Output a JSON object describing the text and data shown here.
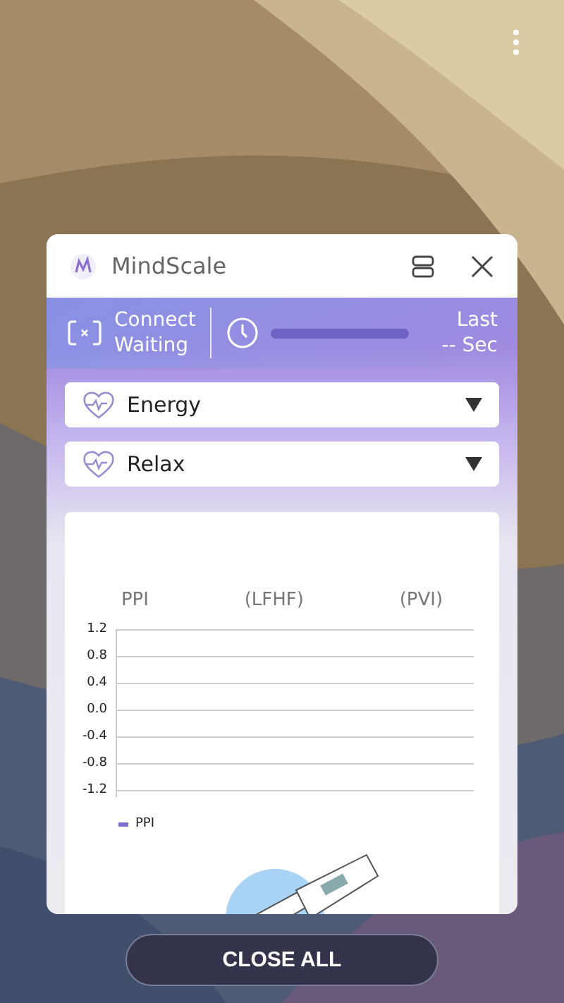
{
  "window": {
    "title": "MindScale"
  },
  "status": {
    "connect_label": "Connect",
    "connect_state": "Waiting",
    "last_label": "Last",
    "last_value": "-- Sec"
  },
  "dropdowns": [
    {
      "label": "Energy"
    },
    {
      "label": "Relax"
    }
  ],
  "chart": {
    "headers": [
      "PPI",
      "(LFHF)",
      "(PVI)"
    ],
    "tick_labels": [
      "1.2",
      "0.8",
      "0.4",
      "0.0",
      "-0.4",
      "-0.8",
      "-1.2"
    ],
    "legend": "PPI"
  },
  "close_all": "CLOSE ALL"
}
